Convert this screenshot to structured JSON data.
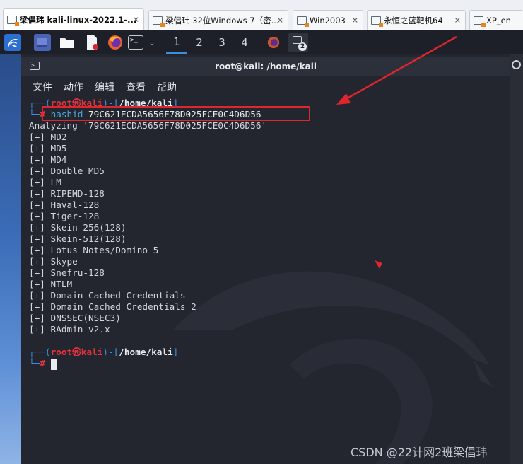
{
  "tabs": [
    {
      "label": "梁倡玮 kali-linux-2022.1-...",
      "active": true
    },
    {
      "label": "梁倡玮 32位Windows 7（密...",
      "active": false
    },
    {
      "label": "Win2003",
      "active": false
    },
    {
      "label": "永恒之蓝靶机64",
      "active": false
    },
    {
      "label": "XP_en",
      "active": false
    }
  ],
  "panel": {
    "workspaces": [
      "1",
      "2",
      "3",
      "4"
    ],
    "terminal_badge": "2"
  },
  "terminal": {
    "title": "root@kali: /home/kali",
    "menu": [
      "文件",
      "动作",
      "编辑",
      "查看",
      "帮助"
    ],
    "prompt1": {
      "open": "┌──(",
      "user": "root㉿kali",
      "mid": ")-[",
      "path": "/home/kali",
      "close": "]"
    },
    "cmd": {
      "branch": "└─",
      "hash_sign": "#",
      "command": "hashid",
      "argument": "79C621ECDA5656F78D025FCE0C4D6D56"
    },
    "output": [
      "Analyzing '79C621ECDA5656F78D025FCE0C4D6D56'",
      "[+] MD2",
      "[+] MD5",
      "[+] MD4",
      "[+] Double MD5",
      "[+] LM",
      "[+] RIPEMD-128",
      "[+] Haval-128",
      "[+] Tiger-128",
      "[+] Skein-256(128)",
      "[+] Skein-512(128)",
      "[+] Lotus Notes/Domino 5",
      "[+] Skype",
      "[+] Snefru-128",
      "[+] NTLM",
      "[+] Domain Cached Credentials",
      "[+] Domain Cached Credentials 2",
      "[+] DNSSEC(NSEC3)",
      "[+] RAdmin v2.x"
    ],
    "prompt2": {
      "open": "┌──(",
      "user": "root㉿kali",
      "mid": ")-[",
      "path": "/home/kali",
      "close": "]"
    },
    "prompt2_end": {
      "branch": "└─",
      "hash_sign": "#"
    }
  },
  "watermark": "CSDN @22计网2班梁倡玮",
  "colors": {
    "accent_blue": "#3b8ee8",
    "prompt_red": "#e8323c",
    "annotation_red": "#e0252d",
    "terminal_bg": "#23262f"
  },
  "icons": [
    "kali-menu-icon",
    "show-desktop-icon",
    "file-manager-icon",
    "text-editor-icon",
    "firefox-icon",
    "terminal-icon",
    "chevron-down-icon",
    "terminal-window-icon"
  ]
}
